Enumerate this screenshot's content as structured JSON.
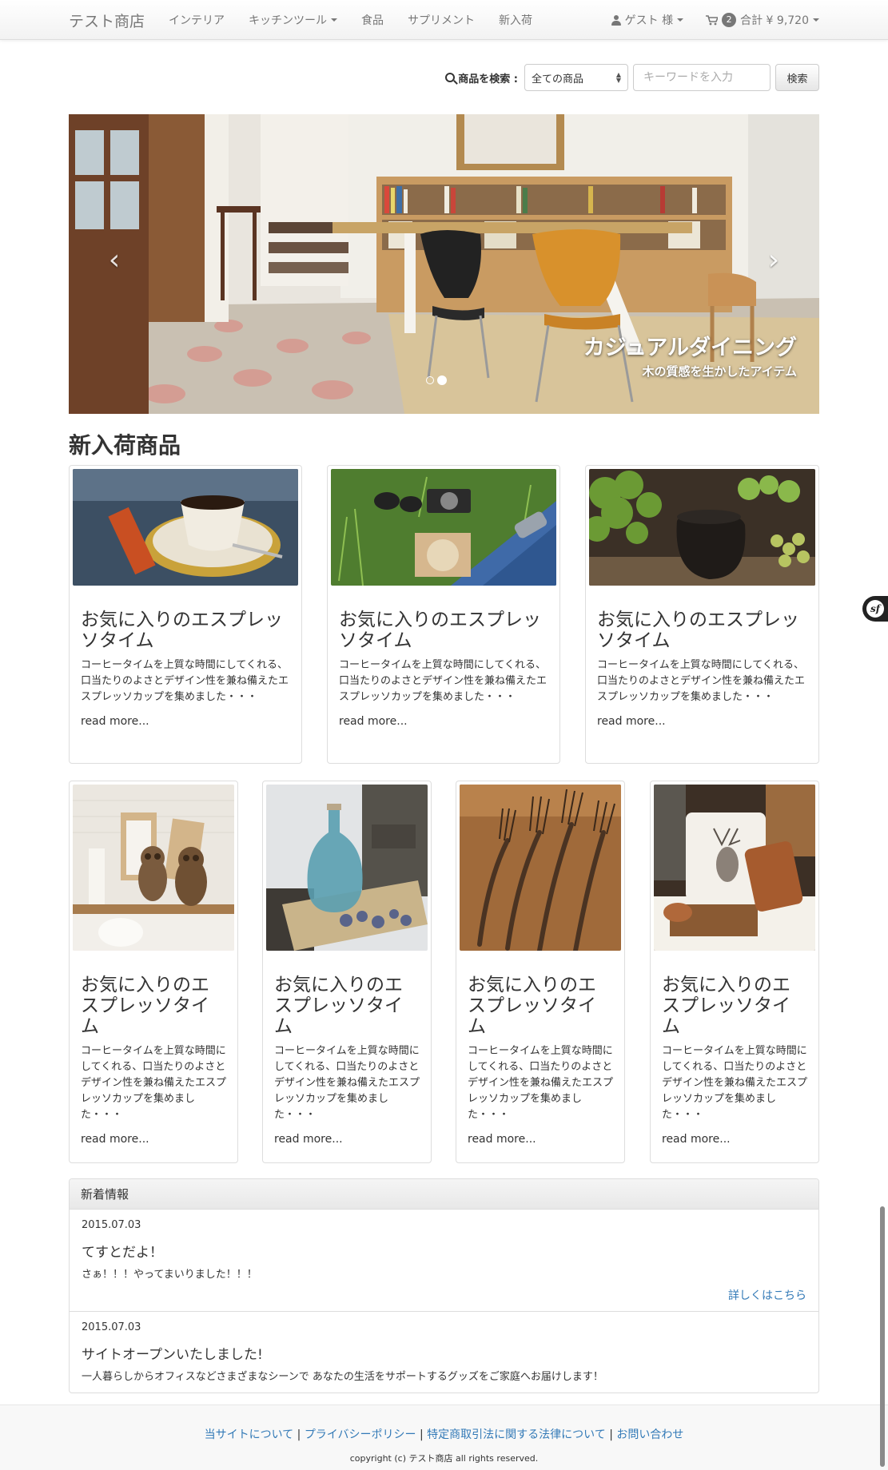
{
  "nav": {
    "brand": "テスト商店",
    "links": [
      {
        "label": "インテリア",
        "dropdown": false
      },
      {
        "label": "キッチンツール",
        "dropdown": true
      },
      {
        "label": "食品",
        "dropdown": false
      },
      {
        "label": "サプリメント",
        "dropdown": false
      },
      {
        "label": "新入荷",
        "dropdown": false
      }
    ],
    "user_label": "ゲスト 様",
    "cart_count": "2",
    "cart_total": "合計 ¥ 9,720"
  },
  "search": {
    "label": "商品を検索 :",
    "category_selected": "全ての商品",
    "keyword_placeholder": "キーワードを入力",
    "button_label": "検索"
  },
  "carousel": {
    "title": "カジュアルダイニング",
    "subtitle": "木の質感を生かしたアイテム",
    "prev_icon": "chevron-left-icon",
    "next_icon": "chevron-right-icon",
    "slide_count": 2,
    "active_index": 1
  },
  "new_arrivals": {
    "heading": "新入荷商品",
    "row1": [
      {
        "title": "お気に入りのエスプレッソタイム",
        "desc": "コーヒータイムを上質な時間にしてくれる、口当たりのよさとデザイン性を兼ね備えたエスプレッソカップを集めました・・・",
        "more": "read more...",
        "image": "espresso-cup"
      },
      {
        "title": "お気に入りのエスプレッソタイム",
        "desc": "コーヒータイムを上質な時間にしてくれる、口当たりのよさとデザイン性を兼ね備えたエスプレッソカップを集めました・・・",
        "more": "read more...",
        "image": "picnic-camera"
      },
      {
        "title": "お気に入りのエスプレッソタイム",
        "desc": "コーヒータイムを上質な時間にしてくれる、口当たりのよさとデザイン性を兼ね備えたエスプレッソカップを集めました・・・",
        "more": "read more...",
        "image": "broccoli-pot"
      }
    ],
    "row2": [
      {
        "title": "お気に入りのエスプレッソタイム",
        "desc": "コーヒータイムを上質な時間にしてくれる、口当たりのよさとデザイン性を兼ね備えたエスプレッソカップを集めました・・・",
        "more": "read more...",
        "image": "owl-shelf"
      },
      {
        "title": "お気に入りのエスプレッソタイム",
        "desc": "コーヒータイムを上質な時間にしてくれる、口当たりのよさとデザイン性を兼ね備えたエスプレッソカップを集めました・・・",
        "more": "read more...",
        "image": "blue-bottle"
      },
      {
        "title": "お気に入りのエスプレッソタイム",
        "desc": "コーヒータイムを上質な時間にしてくれる、口当たりのよさとデザイン性を兼ね備えたエスプレッソカップを集めました・・・",
        "more": "read more...",
        "image": "forks"
      },
      {
        "title": "お気に入りのエスプレッソタイム",
        "desc": "コーヒータイムを上質な時間にしてくれる、口当たりのよさとデザイン性を兼ね備えたエスプレッソカップを集めました・・・",
        "more": "read more...",
        "image": "deer-cushion"
      }
    ]
  },
  "news": {
    "heading": "新着情報",
    "items": [
      {
        "date": "2015.07.03",
        "title": "てすとだよ！",
        "text": "さぁ！！！やってまいりました！！！",
        "link": "詳しくはこちら"
      },
      {
        "date": "2015.07.03",
        "title": "サイトオープンいたしました!",
        "text": "一人暮らしからオフィスなどさまざまなシーンで あなたの生活をサポートするグッズをご家庭へお届けします！"
      }
    ]
  },
  "footer": {
    "links": [
      "当サイトについて",
      "プライバシーポリシー",
      "特定商取引法に関する法律について",
      "お問い合わせ"
    ],
    "separator": "|",
    "copyright": "copyright (c) テスト商店 all rights reserved."
  },
  "widgets": {
    "symfony_icon": "symfony-icon",
    "symfony_text": "sf"
  }
}
